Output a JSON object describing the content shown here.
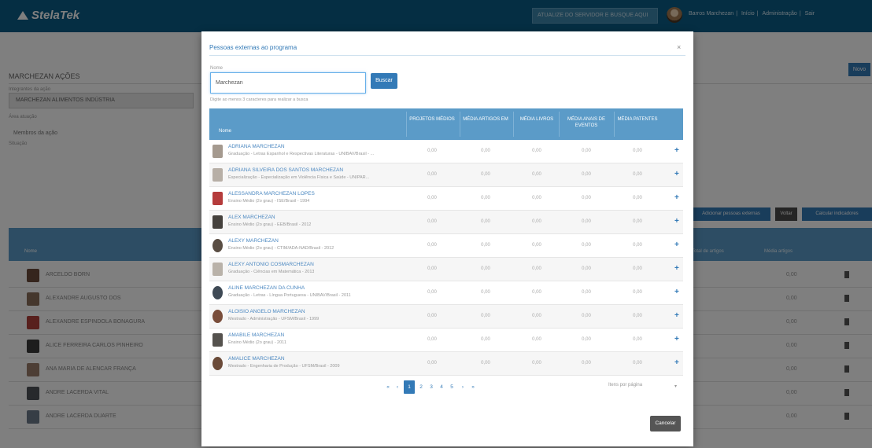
{
  "app": {
    "logo": "StelaTek",
    "search_placeholder": "ATUALIZE DO SERVIDOR E BUSQUE AQUI",
    "top_links": [
      "Barros Marchezan",
      "Início",
      "Administração",
      "Sair"
    ],
    "page_title": "MARCHEZAN AÇÕES",
    "subtitle": "Integrantes da ação",
    "select_value": "MARCHEZAN ALIMENTOS INDÚSTRIA",
    "label2": "Área atuação",
    "value2": "Membros da ação",
    "label3": "Situação",
    "btn_novo": "Novo",
    "btn_a": "Adicionar pessoas externas",
    "btn_b": "Voltar",
    "btn_c": "Calcular indicadores",
    "table_headers": [
      "Nome",
      "Total de artigos",
      "Média artigos"
    ],
    "rows": [
      {
        "name": "ARCELDO BORN",
        "value": "0,00"
      },
      {
        "name": "ALEXANDRE AUGUSTO DOS",
        "value": "0,00"
      },
      {
        "name": "ALEXANDRE ESPINDOLA BONAGURA",
        "value": "0,00"
      },
      {
        "name": "ALICE FERREIRA CARLOS PINHEIRO",
        "value": "0,00"
      },
      {
        "name": "ANA MARIA DE ALENCAR FRANÇA",
        "value": "0,00"
      },
      {
        "name": "ANDRE LACERDA VITAL",
        "value": "0,00"
      },
      {
        "name": "ANDRE LACERDA DUARTE",
        "value": "0,00"
      }
    ]
  },
  "modal": {
    "title": "Pessoas externas ao programa",
    "close": "×",
    "field_label": "Nome",
    "input_value": "Marchezan",
    "search_button": "Buscar",
    "hint": "Digite ao menos 3 caracteres para realizar a busca",
    "headers": {
      "nome": "Nome",
      "c1": "PROJETOS MÉDIOS",
      "c2": "MÉDIA ARTIGOS EM",
      "c3": "MÉDIA LIVROS",
      "c4": "MÉDIA ANAIS DE EVENTOS",
      "c5": "MÉDIA PATENTES"
    },
    "rows": [
      {
        "name": "ADRIANA MARCHEZAN",
        "desc": "Graduação - Letras Espanhol e Respectivas Literaturas - UNIBAV/Brasil - ...",
        "v1": "0,00",
        "v2": "0,00",
        "v3": "0,00",
        "v4": "0,00",
        "v5": "0,00"
      },
      {
        "name": "ADRIANA SILVEIRA DOS SANTOS MARCHEZAN",
        "desc": "Especialização - Especialização em Violência Física e Saúde - UNIPAR...",
        "v1": "0,00",
        "v2": "0,00",
        "v3": "0,00",
        "v4": "0,00",
        "v5": "0,00"
      },
      {
        "name": "ALESSANDRA MARCHEZAN LOPES",
        "desc": "Ensino Médio (2o grau) - ISE/Brasil - 1994",
        "v1": "0,00",
        "v2": "0,00",
        "v3": "0,00",
        "v4": "0,00",
        "v5": "0,00"
      },
      {
        "name": "ALEX MARCHEZAN",
        "desc": "Ensino Médio (2o grau) - EEB/Brasil - 2012",
        "v1": "0,00",
        "v2": "0,00",
        "v3": "0,00",
        "v4": "0,00",
        "v5": "0,00"
      },
      {
        "name": "ALEXY MARCHEZAN",
        "desc": "Ensino Médio (2o grau) - CTIM/ADA-NAD/Brasil - 2012",
        "v1": "0,00",
        "v2": "0,00",
        "v3": "0,00",
        "v4": "0,00",
        "v5": "0,00"
      },
      {
        "name": "ALEXY ANTONIO COSMARCHEZAN",
        "desc": "Graduação - Ciências em Matemática - 2013",
        "v1": "0,00",
        "v2": "0,00",
        "v3": "0,00",
        "v4": "0,00",
        "v5": "0,00"
      },
      {
        "name": "ALINE MARCHEZAN DA CUNHA",
        "desc": "Graduação - Letras - Língua Portuguesa - UNIBAV/Brasil - 2011",
        "v1": "0,00",
        "v2": "0,00",
        "v3": "0,00",
        "v4": "0,00",
        "v5": "0,00"
      },
      {
        "name": "ALOISIO ANGELO MARCHEZAN",
        "desc": "Mestrado - Administração - UFSM/Brasil - 1999",
        "v1": "0,00",
        "v2": "0,00",
        "v3": "0,00",
        "v4": "0,00",
        "v5": "0,00"
      },
      {
        "name": "AMABILE MARCHEZAN",
        "desc": "Ensino Médio (2o grau) - 2011",
        "v1": "0,00",
        "v2": "0,00",
        "v3": "0,00",
        "v4": "0,00",
        "v5": "0,00"
      },
      {
        "name": "AMALICE MARCHEZAN",
        "desc": "Mestrado - Engenharia de Produção - UFSM/Brasil - 2009",
        "v1": "0,00",
        "v2": "0,00",
        "v3": "0,00",
        "v4": "0,00",
        "v5": "0,00"
      }
    ],
    "pagination": {
      "first": "«",
      "prev": "‹",
      "pages": [
        "1",
        "2",
        "3",
        "4",
        "5"
      ],
      "next": "›",
      "last": "»",
      "current": "1"
    },
    "per_page": "Itens por página",
    "cancel": "Cancelar"
  },
  "colors": {
    "topbar": "#0b5d86",
    "accent": "#337ab7",
    "table_header": "#5b9bc8"
  }
}
